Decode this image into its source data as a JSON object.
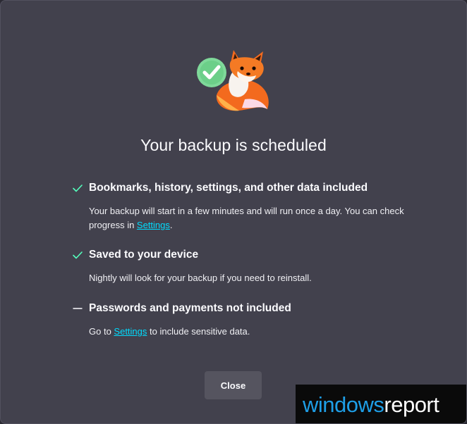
{
  "dialog": {
    "title": "Your backup is scheduled",
    "items": [
      {
        "icon": "checkmark-icon",
        "heading": "Bookmarks, history, settings, and other data included",
        "body_prefix": "Your backup will start in a few minutes and will run once a day. You can check progress in ",
        "link": "Settings",
        "body_suffix": "."
      },
      {
        "icon": "checkmark-icon",
        "heading": "Saved to your device",
        "body_prefix": "Nightly will look for your backup if you need to reinstall."
      },
      {
        "icon": "dash-icon",
        "heading": "Passwords and payments not included",
        "body_prefix": "Go to ",
        "link": "Settings",
        "body_suffix": " to include sensitive data."
      }
    ],
    "close_label": "Close"
  },
  "watermark": {
    "part1": "windows",
    "part2": "report"
  },
  "colors": {
    "background": "#42414d",
    "check": "#54ffbd",
    "link": "#00ddff",
    "button": "#55545f"
  }
}
